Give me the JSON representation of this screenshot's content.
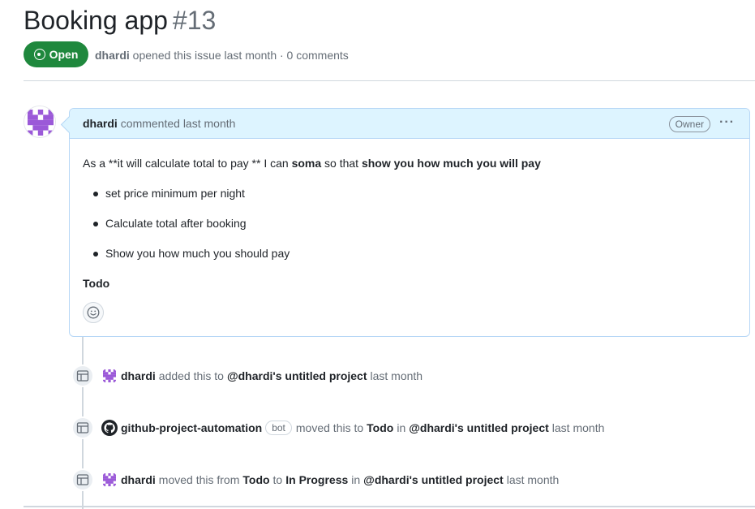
{
  "issue": {
    "title": "Booking app",
    "number": "#13",
    "state": "Open",
    "author": "dhardi",
    "meta_text": "opened this issue last month · 0 comments"
  },
  "comment": {
    "author": "dhardi",
    "time": "commented last month",
    "role_badge": "Owner",
    "menu_glyph": "···",
    "body_intro_1": "As a **it will calculate total to pay ** I can ",
    "body_bold_1": "soma",
    "body_intro_2": " so that ",
    "body_bold_2": "show you how much you will pay",
    "bullets": [
      "set price minimum per night",
      "Calculate total after booking",
      "Show you how much you should pay"
    ],
    "footer_text": "Todo"
  },
  "events": [
    {
      "actor": "dhardi",
      "text_1": "added this to",
      "target": "@dhardi's untitled project",
      "time": "last month"
    },
    {
      "actor": "github-project-automation",
      "badge": "bot",
      "text_1": "moved this to",
      "column": "Todo",
      "text_2": "in",
      "target": "@dhardi's untitled project",
      "time": "last month"
    },
    {
      "actor": "dhardi",
      "text_1": "moved this from",
      "from": "Todo",
      "text_2": "to",
      "to": "In Progress",
      "text_3": "in",
      "target": "@dhardi's untitled project",
      "time": "last month"
    }
  ],
  "colors": {
    "open_green": "#1f883d",
    "comment_header_bg": "#ddf4ff",
    "comment_border": "#b6d7f6",
    "avatar_purple": "#9b59d8"
  },
  "icons": {
    "state": "issue-opened-icon",
    "menu": "kebab-horizontal-icon",
    "reaction": "smiley-icon",
    "event": "table-icon",
    "bot": "github-logo-icon"
  }
}
